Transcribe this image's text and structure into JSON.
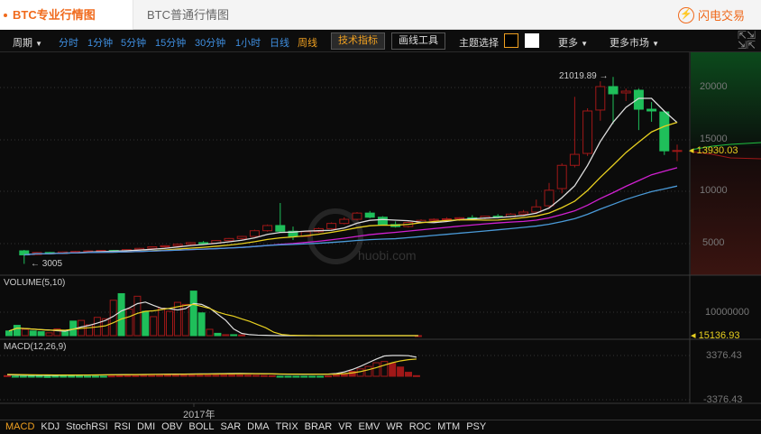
{
  "tabs": {
    "active": "BTC专业行情图",
    "inactive": "BTC普通行情图",
    "flash": "闪电交易"
  },
  "toolbar": {
    "period": "周期",
    "periods": [
      "分时",
      "1分钟",
      "5分钟",
      "15分钟",
      "30分钟",
      "1小时",
      "日线",
      "周线"
    ],
    "tech": "技术指标",
    "draw": "画线工具",
    "theme": "主题选择",
    "more": "更多",
    "more_market": "更多市场"
  },
  "main": {
    "axis": [
      "20000",
      "15000",
      "10000",
      "5000"
    ],
    "high_label": "21019.89",
    "low_label": "3005",
    "last_price": "13930.03",
    "watermark": "huobi.com"
  },
  "volume": {
    "title": "VOLUME(5,10)",
    "axis": "10000000",
    "last": "15136.93"
  },
  "macd": {
    "title": "MACD(12,26,9)",
    "axis_top": "3376.43",
    "axis_bottom": "-3376.43"
  },
  "xaxis": {
    "label": "2017年"
  },
  "indicators": [
    "MACD",
    "KDJ",
    "StochRSI",
    "RSI",
    "DMI",
    "OBV",
    "BOLL",
    "SAR",
    "DMA",
    "TRIX",
    "BRAR",
    "VR",
    "EMV",
    "WR",
    "ROC",
    "MTM",
    "PSY"
  ],
  "colors": {
    "up": "#a01818",
    "down": "#1fbf5a",
    "accent": "#f06a1c",
    "ma5": "#dddddd",
    "ma10": "#e8d020",
    "ma20": "#d020d0",
    "ma30": "#4a9ad8"
  },
  "chart_data": {
    "type": "candlestick",
    "candles": [
      [
        4260,
        4350,
        3005,
        3870
      ],
      [
        3900,
        4150,
        3850,
        4100
      ],
      [
        4100,
        4150,
        3950,
        4000
      ],
      [
        4000,
        4200,
        3950,
        4150
      ],
      [
        4150,
        4250,
        4050,
        4200
      ],
      [
        4200,
        4300,
        4100,
        4250
      ],
      [
        4250,
        4350,
        4150,
        4300
      ],
      [
        4300,
        4350,
        4200,
        4220
      ],
      [
        4220,
        4400,
        4200,
        4380
      ],
      [
        4380,
        4550,
        4300,
        4500
      ],
      [
        4500,
        4700,
        4450,
        4650
      ],
      [
        4650,
        4800,
        4500,
        4750
      ],
      [
        4750,
        4950,
        4650,
        4900
      ],
      [
        4900,
        5100,
        4800,
        5050
      ],
      [
        5050,
        5200,
        4900,
        5000
      ],
      [
        5000,
        5300,
        4950,
        5250
      ],
      [
        5250,
        5500,
        5150,
        5450
      ],
      [
        5450,
        5700,
        5350,
        5650
      ],
      [
        5650,
        6300,
        5600,
        6200
      ],
      [
        6200,
        6800,
        6100,
        6700
      ],
      [
        6700,
        8870,
        6000,
        6150
      ],
      [
        6150,
        6600,
        5300,
        5650
      ],
      [
        5650,
        6200,
        5600,
        6100
      ],
      [
        6100,
        6500,
        6000,
        6400
      ],
      [
        6400,
        7000,
        6300,
        6900
      ],
      [
        6900,
        7500,
        6800,
        7300
      ],
      [
        7300,
        8000,
        7200,
        7900
      ],
      [
        7900,
        8100,
        7400,
        7500
      ],
      [
        7500,
        7600,
        6700,
        6800
      ],
      [
        6800,
        7100,
        6500,
        6600
      ],
      [
        6600,
        7100,
        6500,
        7000
      ],
      [
        7000,
        7300,
        6900,
        7200
      ],
      [
        7200,
        7400,
        7000,
        7300
      ],
      [
        7300,
        7500,
        7100,
        7350
      ],
      [
        7350,
        7500,
        7150,
        7450
      ],
      [
        7450,
        7700,
        7300,
        7400
      ],
      [
        7400,
        7650,
        7300,
        7600
      ],
      [
        7600,
        7800,
        7400,
        7550
      ],
      [
        7550,
        7900,
        7450,
        7800
      ],
      [
        7800,
        8200,
        7700,
        8000
      ],
      [
        8000,
        9200,
        7900,
        8500
      ],
      [
        8600,
        10800,
        8400,
        10100
      ],
      [
        10260,
        12700,
        9800,
        12500
      ],
      [
        12500,
        19100,
        12300,
        13560
      ],
      [
        13650,
        18000,
        13400,
        17740
      ],
      [
        17830,
        20600,
        16800,
        20090
      ],
      [
        20090,
        21019.89,
        16500,
        19390
      ],
      [
        19480,
        19900,
        18700,
        19650
      ],
      [
        19740,
        19900,
        15900,
        17910
      ],
      [
        17910,
        18600,
        16700,
        17740
      ],
      [
        17650,
        17800,
        13500,
        13900
      ],
      [
        13930,
        14500,
        12900,
        13930
      ]
    ],
    "volume": [
      2000000.0,
      4400000.0,
      2700000.0,
      2000000.0,
      1700000.0,
      1200000.0,
      2900000.0,
      1700000.0,
      6200000.0,
      6500000.0,
      4600000.0,
      7800000.0,
      7200000.0,
      15100000.0,
      17900000.0,
      11300000.0,
      16800000.0,
      10400000.0,
      8100000.0,
      11700000.0,
      10400000.0,
      14200000.0,
      13300000.0,
      19000000.0,
      9700000.0,
      2700000.0,
      1000000.0,
      400000.0,
      400000.0,
      300000.0,
      0,
      0,
      0,
      0,
      0,
      0,
      0,
      0,
      0,
      0,
      0,
      0,
      0,
      0,
      0,
      0,
      0,
      0,
      0,
      0,
      0,
      15136.93
    ],
    "volume_up": [
      0,
      0,
      1,
      0,
      0,
      1,
      1,
      0,
      0,
      1,
      1,
      1,
      1,
      1,
      0,
      1,
      1,
      0,
      1,
      1,
      1,
      1,
      1,
      0,
      0,
      1,
      0,
      1,
      0,
      1,
      1,
      1,
      1,
      1,
      1,
      1,
      1,
      1,
      1,
      1,
      1,
      1,
      1,
      1,
      1,
      1,
      1,
      1,
      1,
      1,
      1,
      1
    ],
    "macd_hist": [
      100,
      -100,
      -150,
      -150,
      -150,
      -200,
      -150,
      -150,
      -150,
      -150,
      -150,
      -100,
      -100,
      50,
      80,
      100,
      100,
      120,
      120,
      130,
      150,
      150,
      150,
      160,
      170,
      180,
      180,
      190,
      200,
      200,
      180,
      150,
      120,
      100,
      -150,
      -150,
      -150,
      -150,
      -150,
      -150,
      50,
      200,
      400,
      800,
      1200,
      1600,
      2200,
      2400,
      2100,
      1500,
      650,
      100
    ],
    "macd_dif": [
      250,
      200,
      180,
      170,
      160,
      150,
      150,
      160,
      170,
      180,
      190,
      200,
      220,
      240,
      260,
      270,
      280,
      290,
      300,
      320,
      330,
      350,
      360,
      370,
      380,
      390,
      400,
      420,
      450,
      460,
      450,
      430,
      400,
      380,
      350,
      330,
      320,
      310,
      310,
      320,
      350,
      450,
      700,
      1100,
      1600,
      2200,
      2800,
      3300,
      3376,
      3376,
      3350,
      3100
    ],
    "macd_dea": [
      300,
      280,
      260,
      240,
      230,
      220,
      210,
      200,
      200,
      200,
      210,
      220,
      230,
      240,
      250,
      260,
      270,
      280,
      290,
      300,
      310,
      320,
      330,
      340,
      350,
      360,
      370,
      380,
      390,
      400,
      400,
      400,
      390,
      380,
      370,
      360,
      350,
      340,
      330,
      330,
      330,
      350,
      420,
      550,
      750,
      1050,
      1400,
      1800,
      2200,
      2500,
      2700,
      2800
    ],
    "ylim_price": [
      0,
      22000
    ],
    "x_label": "2017年"
  }
}
